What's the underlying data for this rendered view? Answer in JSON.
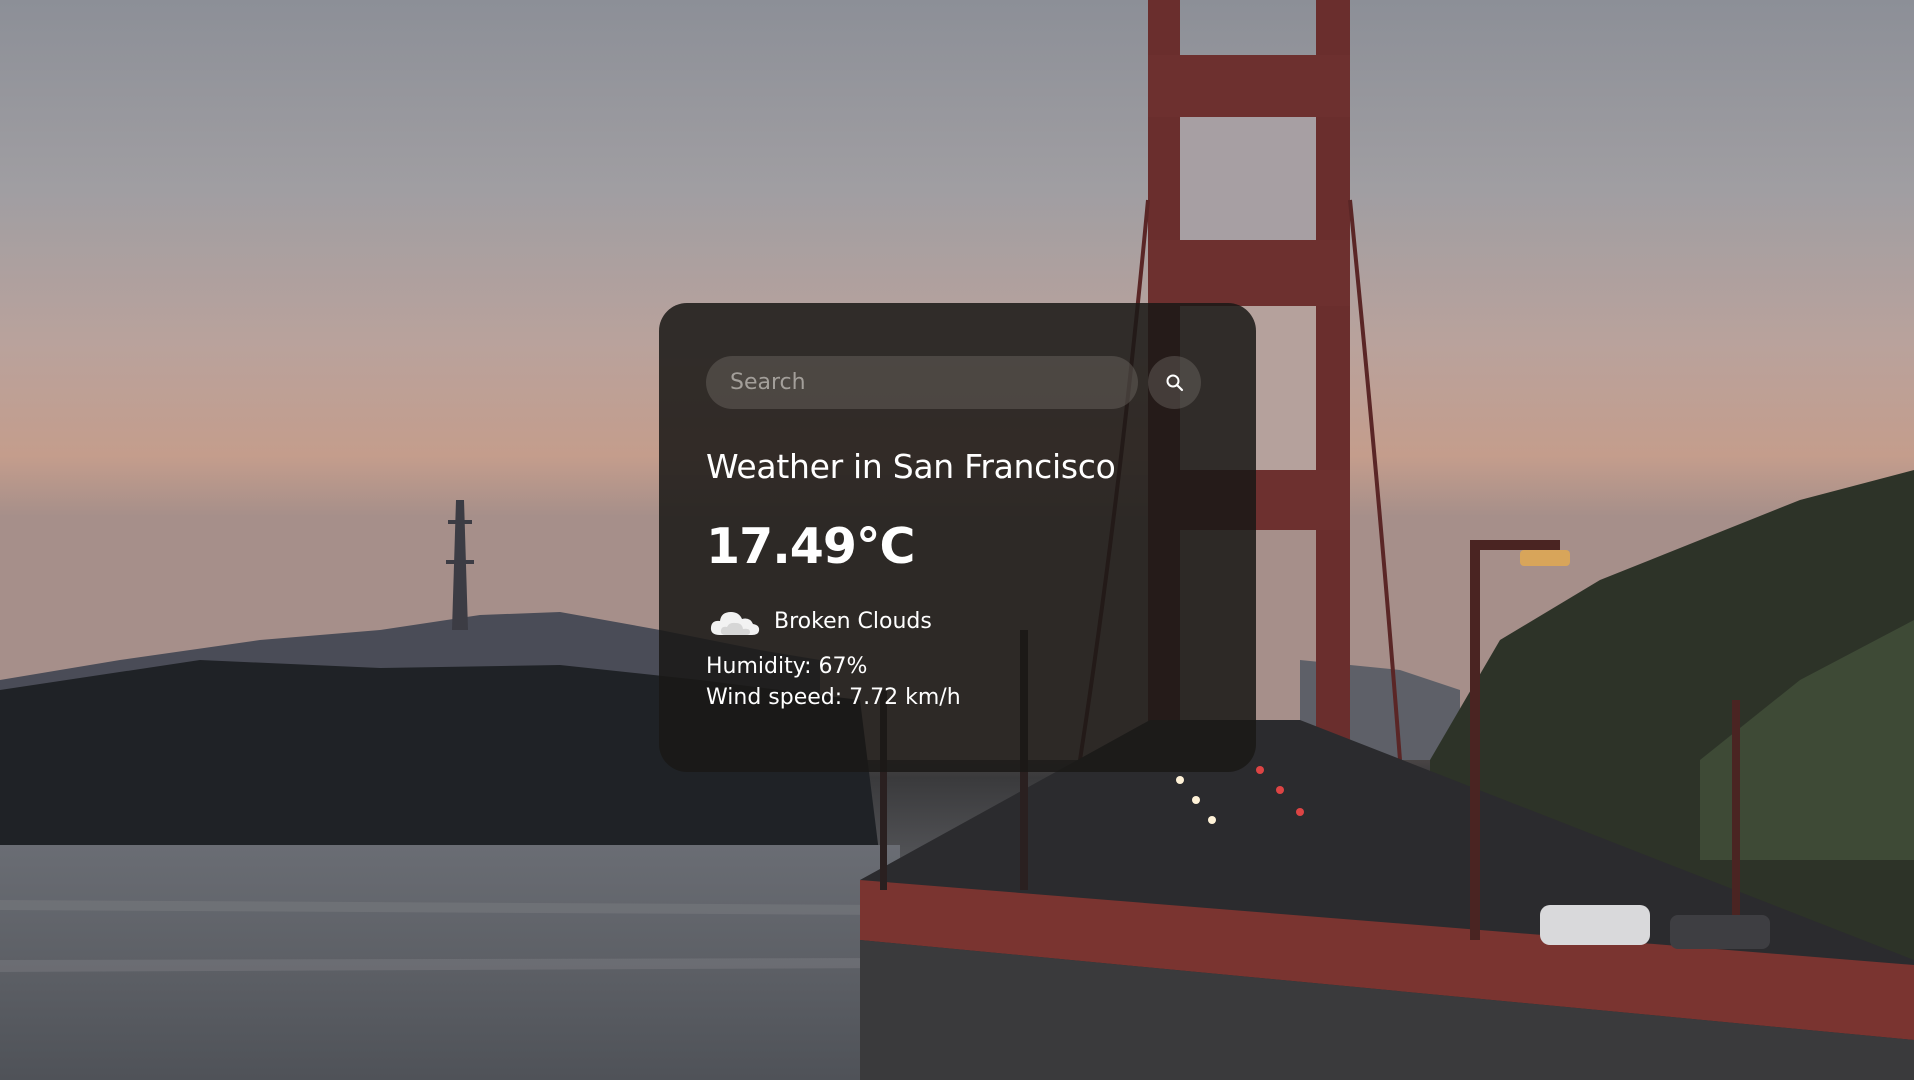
{
  "search": {
    "placeholder": "Search",
    "button_icon": "search-icon"
  },
  "weather": {
    "title": "Weather in San Francisco",
    "temperature": "17.49°C",
    "icon": "broken-clouds-icon",
    "description": "Broken Clouds",
    "humidity": "Humidity: 67%",
    "wind": "Wind speed: 7.72 km/h"
  },
  "colors": {
    "card_background": "#1a1816",
    "text": "#ffffff",
    "input_background": "#5a5550"
  }
}
